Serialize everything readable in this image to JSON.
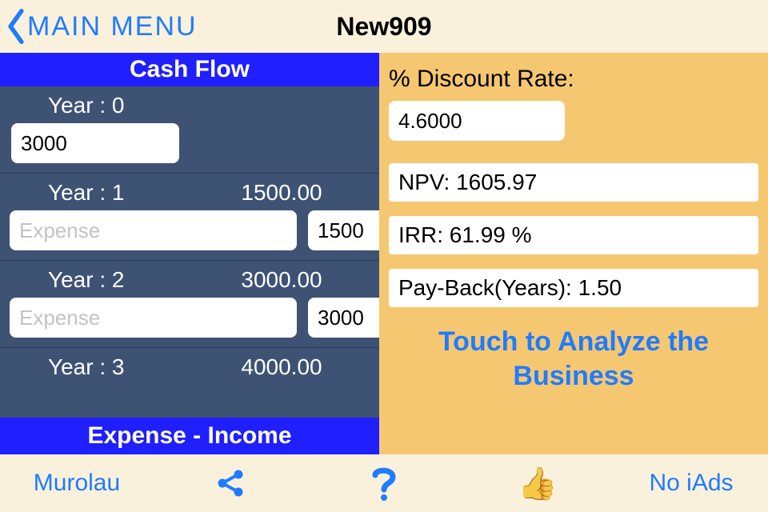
{
  "nav": {
    "back_label": "MAIN MENU",
    "title": "New909"
  },
  "left": {
    "header": "Cash Flow",
    "footer": "Expense - Income",
    "year0": {
      "label": "Year : 0",
      "value": "3000"
    },
    "year1": {
      "label": "Year : 1",
      "total": "1500.00",
      "expense_ph": "Expense",
      "income": "1500"
    },
    "year2": {
      "label": "Year : 2",
      "total": "3000.00",
      "expense_ph": "Expense",
      "income": "3000"
    },
    "year3": {
      "label": "Year : 3",
      "total": "4000.00"
    }
  },
  "right": {
    "discount_label": "% Discount Rate:",
    "discount_value": "4.6000",
    "npv": "NPV:  1605.97",
    "irr": "IRR:  61.99 %",
    "payback": "Pay-Back(Years):  1.50",
    "analyze": "Touch to Analyze the Business"
  },
  "toolbar": {
    "brand": "Murolau",
    "noiads": "No iAds"
  }
}
